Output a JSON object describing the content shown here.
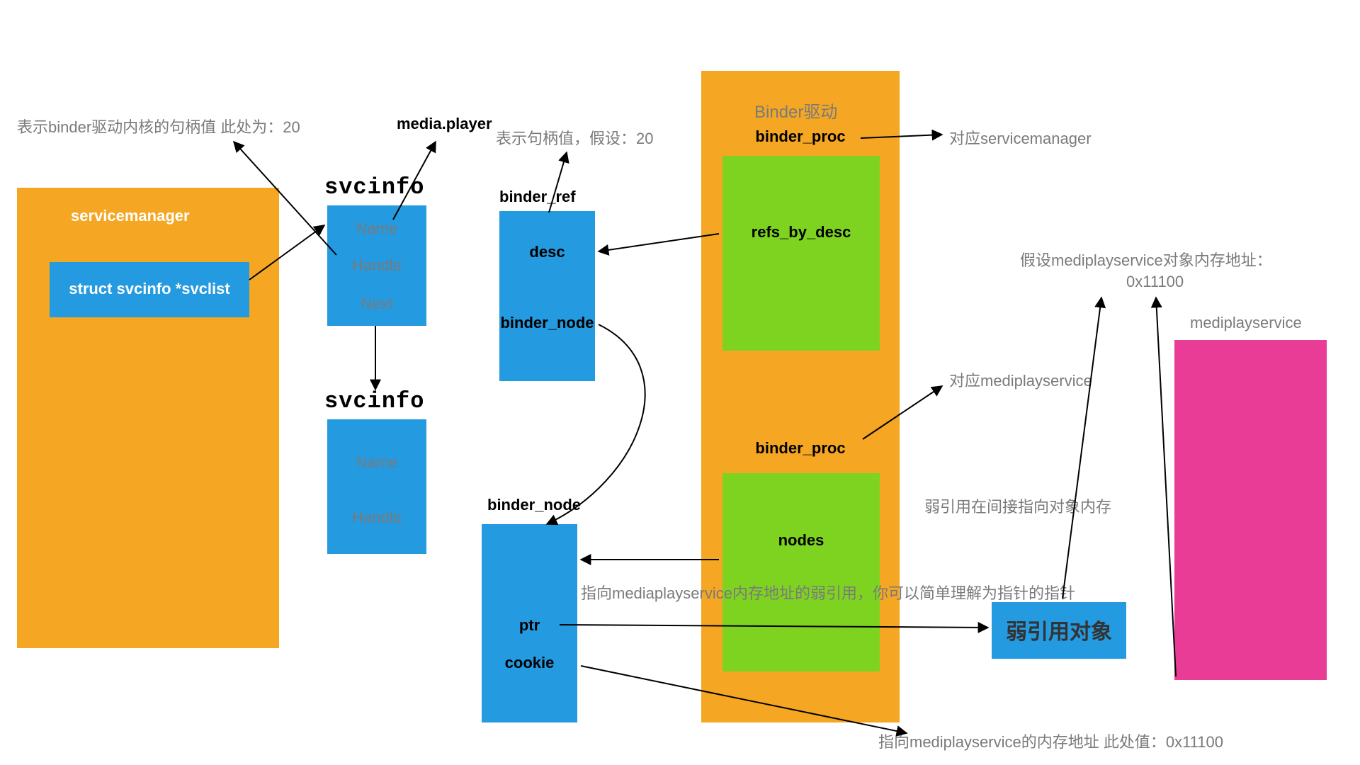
{
  "annotations": {
    "handle20": "表示binder驱动内核的句柄值 此处为：20",
    "mediaPlayer": "media.player",
    "descHandle": "表示句柄值，假设：20",
    "binderDriver": "Binder驱动",
    "corrSvcMgr": "对应servicemanager",
    "corrMedia": "对应mediplayservice",
    "weakIndirect": "弱引用在间接指向对象内存",
    "weakExplain": "指向mediaplayservice内存地址的弱引用，你可以简单理解为指针的指针",
    "memAssume": "假设mediplayservice对象内存地址：",
    "memAddr": "0x11100",
    "cookiePoints": "指向mediplayservice的内存地址 此处值：0x11100"
  },
  "servicemanager": {
    "title": "servicemanager",
    "listField": "struct svcinfo *svclist"
  },
  "svcinfo": {
    "header": "svcinfo",
    "name": "Name",
    "handle": "Handle",
    "next": "Next"
  },
  "binderRef": {
    "title": "binder_ref",
    "desc": "desc",
    "node": "binder_node"
  },
  "binderNode": {
    "title": "binder_node",
    "ptr": "ptr",
    "cookie": "cookie"
  },
  "binderProc1": {
    "title": "binder_proc",
    "field": "refs_by_desc"
  },
  "binderProc2": {
    "title": "binder_proc",
    "field": "nodes"
  },
  "weakRef": {
    "label": "弱引用对象"
  },
  "mediaService": {
    "title": "mediplayservice"
  }
}
